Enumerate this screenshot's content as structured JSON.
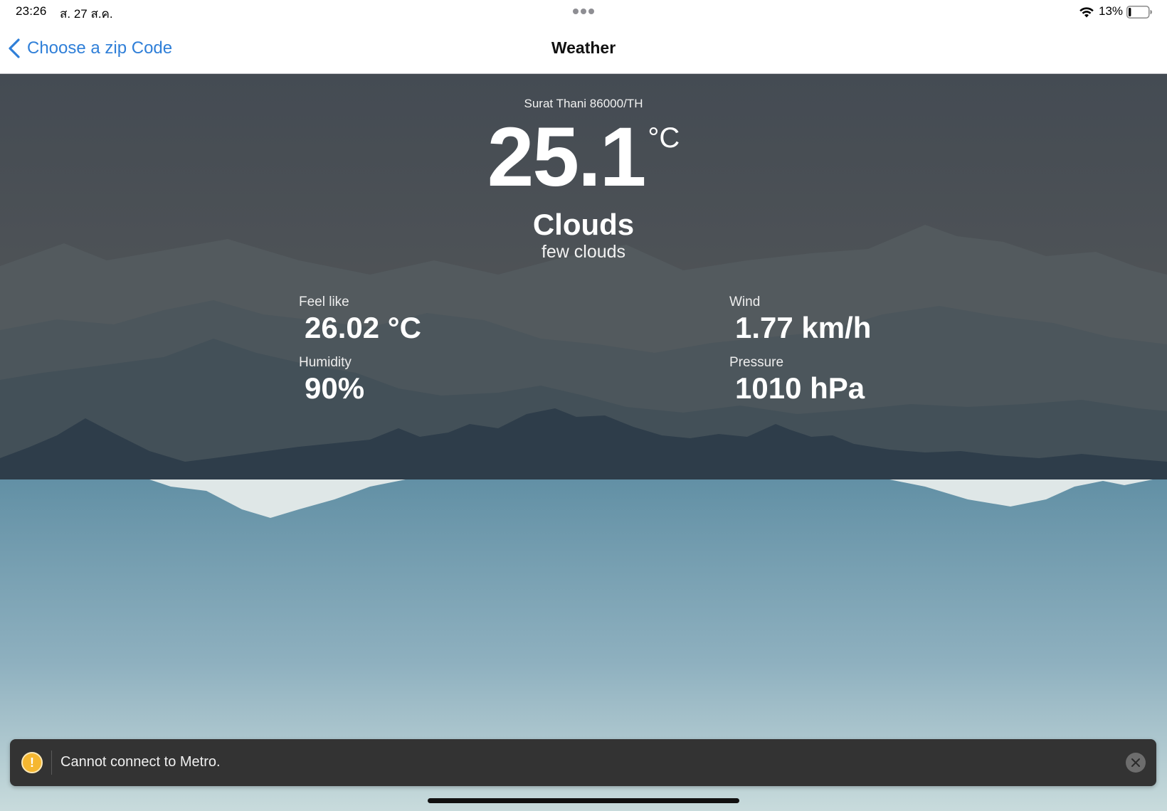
{
  "status_bar": {
    "time": "23:26",
    "date": "ส. 27 ส.ค.",
    "battery_percent": "13%",
    "battery_level": 0.13,
    "icons": [
      "multitask-dots",
      "wifi-icon",
      "battery-icon"
    ]
  },
  "nav": {
    "back_label": "Choose a zip Code",
    "title": "Weather",
    "back_icon": "chevron-left-icon"
  },
  "weather": {
    "location": "Surat Thani 86000/TH",
    "temperature": "25.1",
    "temperature_unit": "°C",
    "condition": "Clouds",
    "description": "few clouds",
    "metrics": {
      "feel_like": {
        "label": "Feel like",
        "value": "26.02 °C"
      },
      "humidity": {
        "label": "Humidity",
        "value": "90%"
      },
      "wind": {
        "label": "Wind",
        "value": "1.77 km/h"
      },
      "pressure": {
        "label": "Pressure",
        "value": "1010 hPa"
      }
    }
  },
  "toast": {
    "message": "Cannot connect to Metro.",
    "icon": "warning-icon",
    "close_icon": "close-icon"
  },
  "colors": {
    "accent_blue": "#2f7fd8",
    "sky_top": "#464d54",
    "mountain_dark": "#2c3b48",
    "water_top": "#6593a7",
    "water_bottom": "#c4d8da",
    "toast_bg": "#333333",
    "warning": "#f5b731"
  }
}
